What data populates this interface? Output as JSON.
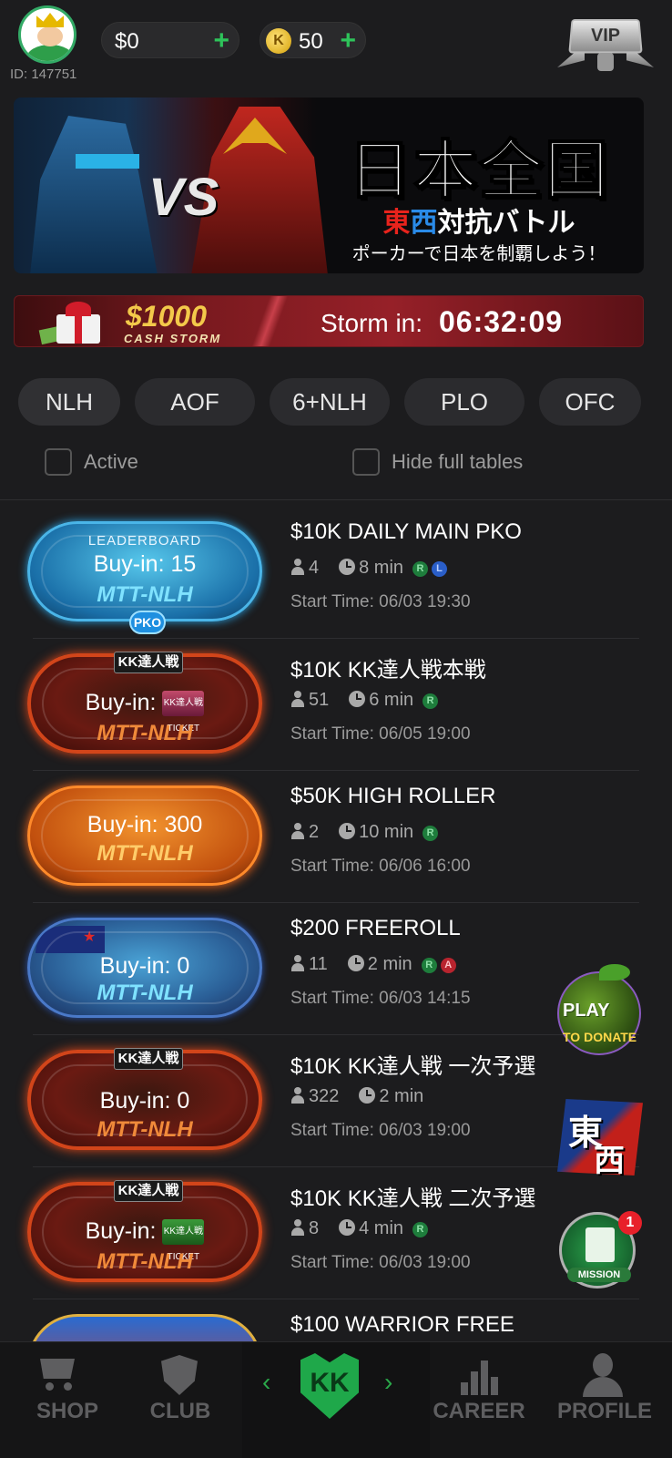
{
  "header": {
    "user_id": "ID: 147751",
    "cash_balance": "$0",
    "coin_balance": "50",
    "coin_symbol": "K",
    "add_symbol": "+",
    "vip_label": "VIP"
  },
  "banner": {
    "title": "日本全国",
    "subtitle_east": "東",
    "subtitle_west": "西",
    "subtitle_rest": "対抗バトル",
    "tagline": "ポーカーで日本を制覇しよう！",
    "vs_text": "VS"
  },
  "storm": {
    "amount": "$1000",
    "name": "CASH STORM",
    "label": "Storm in:",
    "countdown": "06:32:09"
  },
  "tabs": [
    "NLH",
    "AOF",
    "6+NLH",
    "PLO",
    "OFC"
  ],
  "filters": {
    "active_label": "Active",
    "hide_full_label": "Hide full tables"
  },
  "tournaments": [
    {
      "title": "$10K DAILY MAIN PKO",
      "players": "4",
      "duration": "8 min",
      "start": "Start Time: 06/03 19:30",
      "buyin": "Buy-in: 15",
      "type": "MTT-NLH",
      "ribbon": "LEADERBOARD",
      "tag": "PKO",
      "badges": [
        "R",
        "L"
      ]
    },
    {
      "title": "$10K KK達人戦本戦",
      "players": "51",
      "duration": "6 min",
      "start": "Start Time: 06/05 19:00",
      "buyin": "Buy-in:",
      "type": "MTT-NLH",
      "logo": "KK達人戦",
      "ticket": "KK達人戦 TICKET",
      "badges": [
        "R"
      ]
    },
    {
      "title": "$50K HIGH ROLLER",
      "players": "2",
      "duration": "10 min",
      "start": "Start Time: 06/06 16:00",
      "buyin": "Buy-in: 300",
      "type": "MTT-NLH",
      "badges": [
        "R"
      ]
    },
    {
      "title": "$200 FREEROLL",
      "players": "11",
      "duration": "2 min",
      "start": "Start Time: 06/03 14:15",
      "buyin": "Buy-in: 0",
      "type": "MTT-NLH",
      "badges": [
        "R",
        "A"
      ]
    },
    {
      "title": "$10K KK達人戦 一次予選",
      "players": "322",
      "duration": "2 min",
      "start": "Start Time: 06/03 19:00",
      "buyin": "Buy-in: 0",
      "type": "MTT-NLH",
      "logo": "KK達人戦",
      "badges": []
    },
    {
      "title": "$10K KK達人戦 二次予選",
      "players": "8",
      "duration": "4 min",
      "start": "Start Time: 06/03 19:00",
      "buyin": "Buy-in:",
      "type": "MTT-NLH",
      "logo": "KK達人戦",
      "ticket": "KK達人戦 TICKET",
      "badges": [
        "R"
      ]
    },
    {
      "title": "$100 WARRIOR FREE",
      "badges": []
    }
  ],
  "side_buttons": {
    "play_top": "PLAY",
    "play_bottom": "TO DONATE",
    "tozai_1": "東",
    "tozai_2": "西",
    "mission_label": "MISSION",
    "mission_count": "1"
  },
  "nav": {
    "shop": "SHOP",
    "club": "CLUB",
    "center": "KK",
    "career": "CAREER",
    "profile": "PROFILE",
    "prev": "‹",
    "next": "›"
  },
  "colors": {
    "accent_green": "#2ec35a",
    "gold": "#f3c94a",
    "background": "#1c1c1e"
  }
}
